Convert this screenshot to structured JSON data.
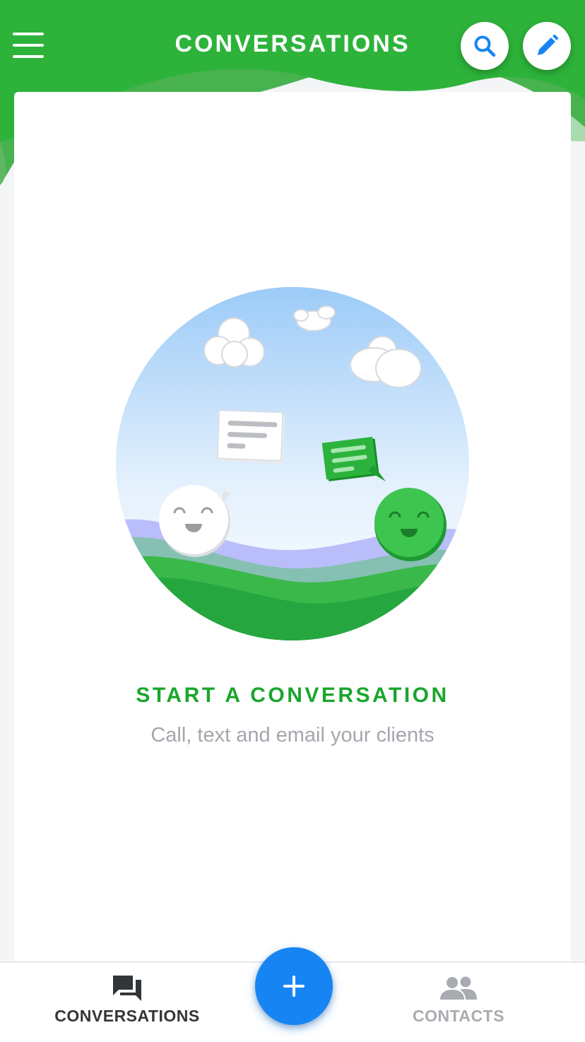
{
  "header": {
    "title": "CONVERSATIONS",
    "menu_icon": "hamburger-menu-icon",
    "search_icon": "search-icon",
    "compose_icon": "pencil-icon"
  },
  "empty_state": {
    "illustration": "two smiling faces chatting on a green hill",
    "title": "START A CONVERSATION",
    "subtitle": "Call, text and email your clients"
  },
  "bottom_nav": {
    "tabs": [
      {
        "label": "CONVERSATIONS",
        "icon": "chat-bubbles-icon",
        "active": true
      },
      {
        "label": "CONTACTS",
        "icon": "people-icon",
        "active": false
      }
    ],
    "fab_icon": "plus-icon"
  },
  "colors": {
    "brand_green": "#2db33a",
    "title_green": "#1aa62c",
    "fab_blue": "#1685f3",
    "icon_blue": "#1685f3"
  }
}
